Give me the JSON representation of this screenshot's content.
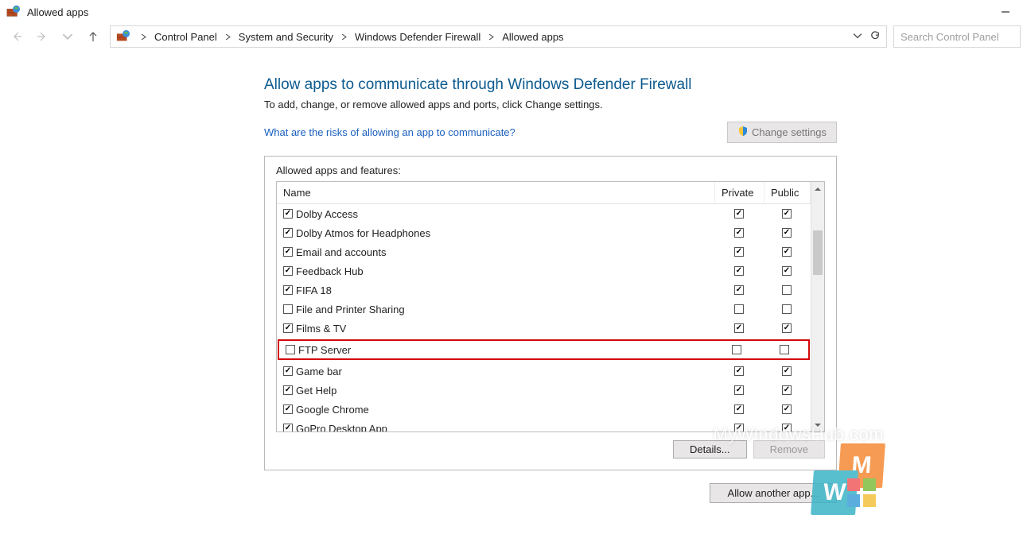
{
  "window": {
    "title": "Allowed apps",
    "search_placeholder": "Search Control Panel"
  },
  "breadcrumb": [
    "Control Panel",
    "System and Security",
    "Windows Defender Firewall",
    "Allowed apps"
  ],
  "page": {
    "heading": "Allow apps to communicate through Windows Defender Firewall",
    "subtext": "To add, change, or remove allowed apps and ports, click Change settings.",
    "risk_link": "What are the risks of allowing an app to communicate?",
    "change_settings_label": "Change settings"
  },
  "table": {
    "group_label": "Allowed apps and features:",
    "columns": {
      "name": "Name",
      "private": "Private",
      "public": "Public"
    },
    "rows": [
      {
        "enabled": true,
        "name": "Dolby Access",
        "private": true,
        "public": true,
        "highlight": false
      },
      {
        "enabled": true,
        "name": "Dolby Atmos for Headphones",
        "private": true,
        "public": true,
        "highlight": false
      },
      {
        "enabled": true,
        "name": "Email and accounts",
        "private": true,
        "public": true,
        "highlight": false
      },
      {
        "enabled": true,
        "name": "Feedback Hub",
        "private": true,
        "public": true,
        "highlight": false
      },
      {
        "enabled": true,
        "name": "FIFA 18",
        "private": true,
        "public": false,
        "highlight": false
      },
      {
        "enabled": false,
        "name": "File and Printer Sharing",
        "private": false,
        "public": false,
        "highlight": false
      },
      {
        "enabled": true,
        "name": "Films & TV",
        "private": true,
        "public": true,
        "highlight": false
      },
      {
        "enabled": false,
        "name": "FTP Server",
        "private": false,
        "public": false,
        "highlight": true
      },
      {
        "enabled": true,
        "name": "Game bar",
        "private": true,
        "public": true,
        "highlight": false
      },
      {
        "enabled": true,
        "name": "Get Help",
        "private": true,
        "public": true,
        "highlight": false
      },
      {
        "enabled": true,
        "name": "Google Chrome",
        "private": true,
        "public": true,
        "highlight": false
      },
      {
        "enabled": true,
        "name": "GoPro Desktop App",
        "private": true,
        "public": true,
        "highlight": false
      }
    ]
  },
  "buttons": {
    "details": "Details...",
    "remove": "Remove",
    "allow_another": "Allow another app..."
  },
  "watermark": "MyWindowsHub.com",
  "logo": {
    "m": "M",
    "w": "W"
  }
}
